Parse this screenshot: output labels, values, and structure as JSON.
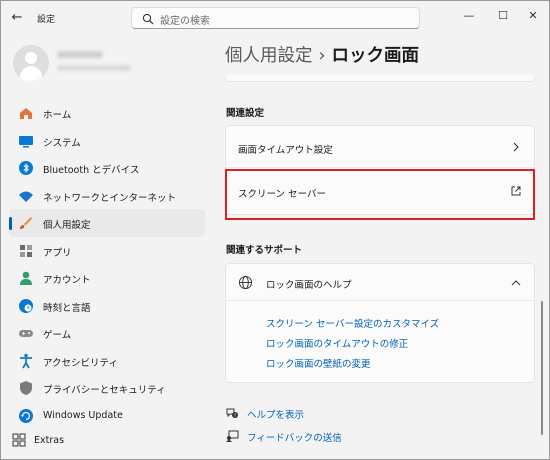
{
  "window": {
    "app_title": "設定",
    "search_placeholder": "設定の検索",
    "back_icon": "back-arrow-icon",
    "minimize_glyph": "—",
    "maximize_glyph": "☐",
    "close_glyph": "✕"
  },
  "user": {
    "avatar_icon": "person-icon"
  },
  "nav": {
    "items": [
      {
        "label": "ホーム",
        "icon": "home-icon",
        "color": "#e0763a"
      },
      {
        "label": "システム",
        "icon": "monitor-icon",
        "color": "#0a78d4"
      },
      {
        "label": "Bluetooth とデバイス",
        "icon": "bluetooth-icon",
        "color": "#0a78d4"
      },
      {
        "label": "ネットワークとインターネット",
        "icon": "wifi-icon",
        "color": "#1b74c9"
      },
      {
        "label": "個人用設定",
        "icon": "brush-icon",
        "color": "#e5893a",
        "active": true
      },
      {
        "label": "アプリ",
        "icon": "apps-icon",
        "color": "#6b6b6b"
      },
      {
        "label": "アカウント",
        "icon": "account-icon",
        "color": "#2e9f6b"
      },
      {
        "label": "時刻と言語",
        "icon": "globe-clock-icon",
        "color": "#0a78d4"
      },
      {
        "label": "ゲーム",
        "icon": "gamepad-icon",
        "color": "#8a8a8a"
      },
      {
        "label": "アクセシビリティ",
        "icon": "accessibility-icon",
        "color": "#1d73c4"
      },
      {
        "label": "プライバシーとセキュリティ",
        "icon": "shield-icon",
        "color": "#7a7a7a"
      },
      {
        "label": "Windows Update",
        "icon": "update-icon",
        "color": "#0a78d4"
      }
    ],
    "extras_label": "Extras"
  },
  "breadcrumb": {
    "parent": "個人用設定",
    "separator": "›",
    "current": "ロック画面"
  },
  "related": {
    "title": "関連設定",
    "items": [
      {
        "label": "画面タイムアウト設定",
        "trail_icon": "chevron-right-icon"
      },
      {
        "label": "スクリーン セーバー",
        "trail_icon": "open-external-icon"
      }
    ]
  },
  "support": {
    "title": "関連するサポート",
    "header_label": "ロック画面のヘルプ",
    "header_icon": "globe-icon",
    "links": [
      "スクリーン セーバー設定のカスタマイズ",
      "ロック画面のタイムアウトの修正",
      "ロック画面の壁紙の変更"
    ]
  },
  "footer": {
    "help_label": "ヘルプを表示",
    "feedback_label": "フィードバックの送信"
  },
  "colors": {
    "accent": "#005fb8",
    "link": "#0060b8",
    "highlight": "#e01e22",
    "window_bg": "#f3f3f3",
    "card_bg": "#fbfbfb"
  }
}
